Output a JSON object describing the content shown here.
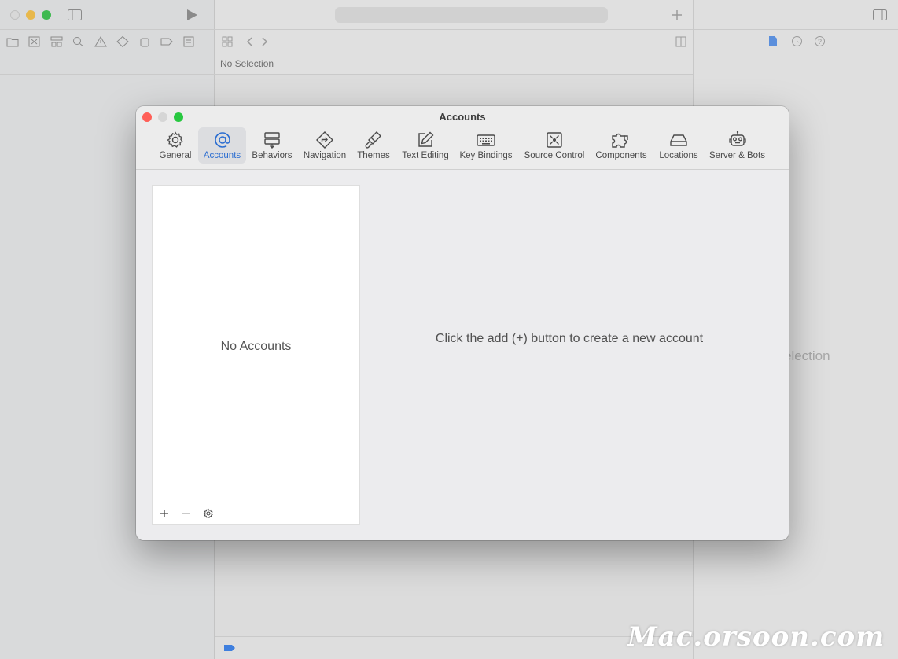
{
  "background_window": {
    "selection_label": "No Selection",
    "inspector_label": "election",
    "icons": [
      "sidebar-icon",
      "run-icon",
      "add-icon",
      "inspector-toggle-icon"
    ]
  },
  "preferences": {
    "title": "Accounts",
    "toolbar": [
      {
        "label": "General",
        "icon": "gear-icon",
        "selected": false
      },
      {
        "label": "Accounts",
        "icon": "at-icon",
        "selected": true
      },
      {
        "label": "Behaviors",
        "icon": "behaviors-icon",
        "selected": false
      },
      {
        "label": "Navigation",
        "icon": "navigation-icon",
        "selected": false
      },
      {
        "label": "Themes",
        "icon": "brush-icon",
        "selected": false
      },
      {
        "label": "Text Editing",
        "icon": "pencil-square-icon",
        "selected": false
      },
      {
        "label": "Key Bindings",
        "icon": "keyboard-icon",
        "selected": false
      },
      {
        "label": "Source Control",
        "icon": "source-control-icon",
        "selected": false
      },
      {
        "label": "Components",
        "icon": "puzzle-icon",
        "selected": false
      },
      {
        "label": "Locations",
        "icon": "drive-icon",
        "selected": false
      },
      {
        "label": "Server & Bots",
        "icon": "robot-icon",
        "selected": false
      }
    ],
    "accounts_list": {
      "empty_label": "No Accounts",
      "tools": [
        "add-icon",
        "remove-icon",
        "gear-icon"
      ]
    },
    "hint": "Click the add (+) button to create a new account"
  },
  "watermark": "Mac.orsoon.com",
  "colors": {
    "accent": "#2c6ed1",
    "close": "#ff5f57",
    "minimize": "#febc2e",
    "zoom": "#28c840"
  }
}
